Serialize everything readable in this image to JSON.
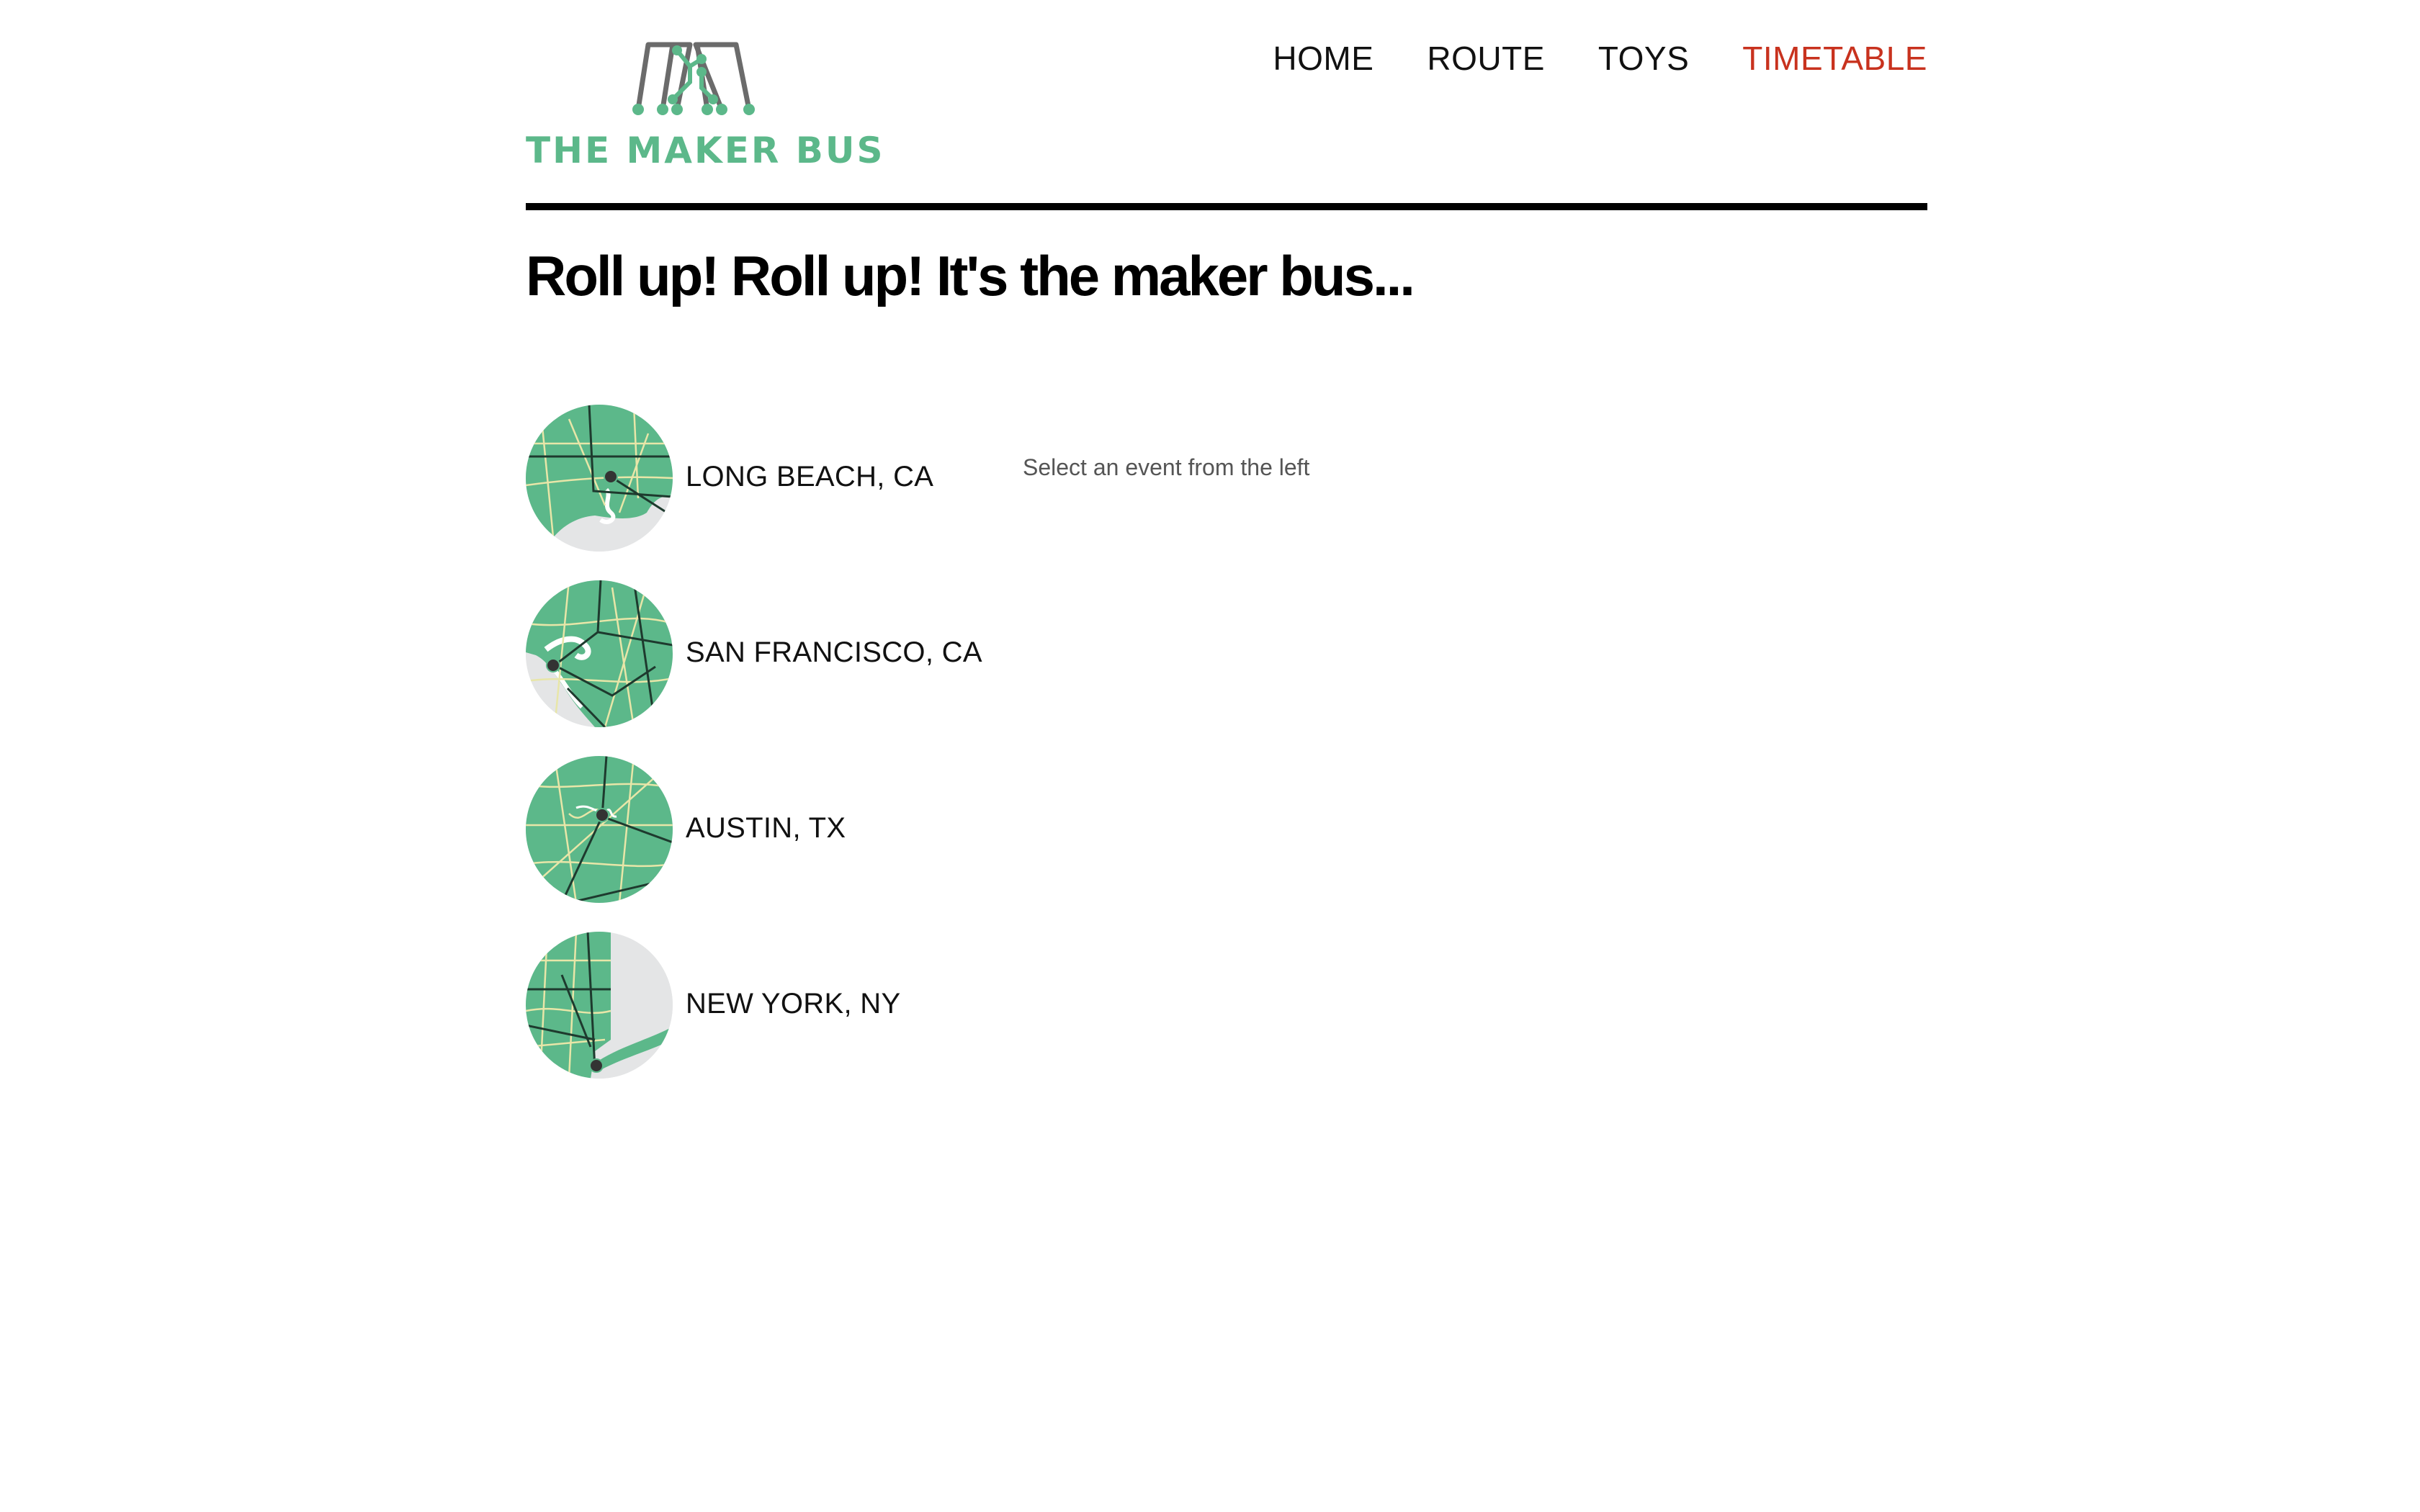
{
  "brand": {
    "logo_text": "THE MAKER BUS",
    "logo_icon": "maker-bus-circuit-logo",
    "colors": {
      "brand_green": "#5cb88a",
      "logo_gray": "#6b6b6b",
      "active_nav": "#c8321e"
    }
  },
  "nav": {
    "items": [
      {
        "label": "HOME",
        "active": false
      },
      {
        "label": "ROUTE",
        "active": false
      },
      {
        "label": "TOYS",
        "active": false
      },
      {
        "label": "TIMETABLE",
        "active": true
      }
    ]
  },
  "main": {
    "title": "Roll up! Roll up! It's the maker bus...",
    "hint": "Select an event from the left",
    "events": [
      {
        "label": "LONG BEACH, CA",
        "map_icon": "long-beach-map-icon"
      },
      {
        "label": "SAN FRANCISCO, CA",
        "map_icon": "san-francisco-map-icon"
      },
      {
        "label": "AUSTIN, TX",
        "map_icon": "austin-map-icon"
      },
      {
        "label": "NEW YORK, NY",
        "map_icon": "new-york-map-icon"
      }
    ]
  }
}
